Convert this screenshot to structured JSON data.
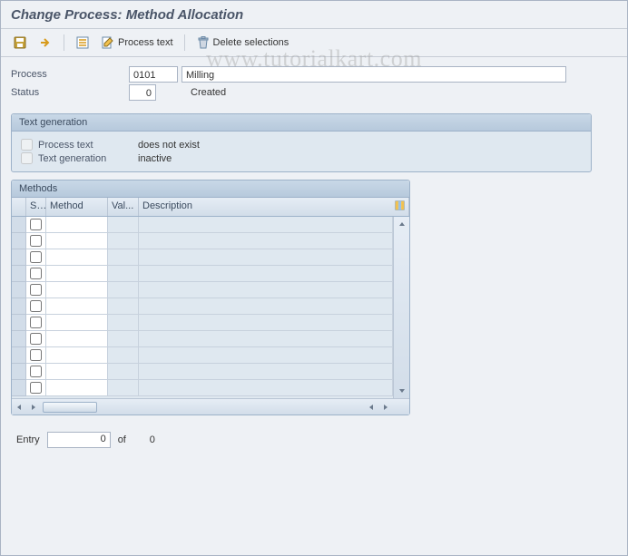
{
  "title": "Change Process: Method Allocation",
  "watermark": "www.tutorialkart.com",
  "toolbar": {
    "process_text_label": "Process text",
    "delete_selections_label": "Delete selections"
  },
  "header": {
    "process_label": "Process",
    "process_code": "0101",
    "process_name": "Milling",
    "status_label": "Status",
    "status_code": "0",
    "status_text": "Created"
  },
  "text_gen_group": {
    "title": "Text generation",
    "row1_label": "Process text",
    "row1_value": "does not exist",
    "row2_label": "Text generation",
    "row2_value": "inactive"
  },
  "methods_group": {
    "title": "Methods",
    "columns": {
      "s": "S..",
      "method": "Method",
      "val": "Val...",
      "desc": "Description"
    },
    "row_count": 11
  },
  "entry_bar": {
    "label": "Entry",
    "value": "0",
    "of_label": "of",
    "total": "0"
  }
}
